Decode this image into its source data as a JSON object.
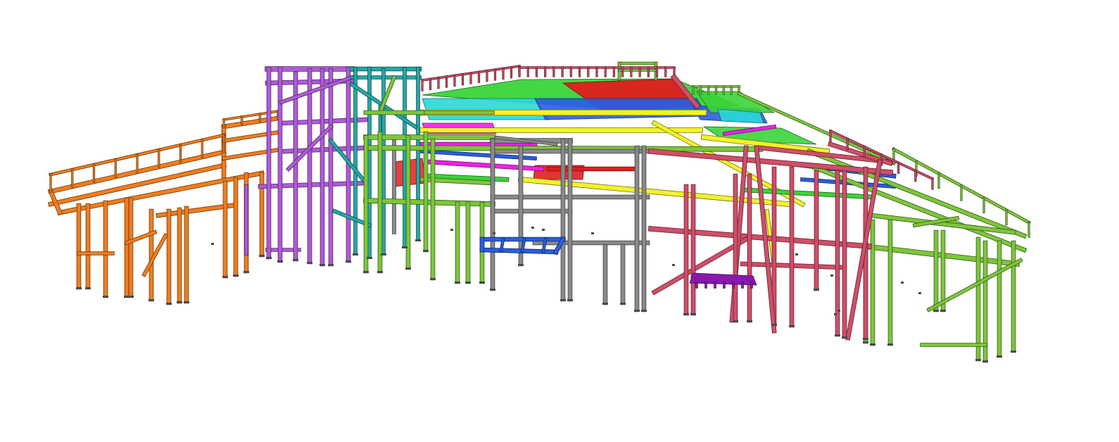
{
  "scene": {
    "background": "#ffffff",
    "groups": [
      {
        "key": "orange",
        "name": "orange-walkway-frame",
        "color": "#f07d1e"
      },
      {
        "key": "violet",
        "name": "violet-tower-frame",
        "color": "#b05ad8"
      },
      {
        "key": "teal",
        "name": "teal-stair-tower-frame",
        "color": "#23a7a7"
      },
      {
        "key": "lime",
        "name": "lime-main-frame",
        "color": "#7cc63b"
      },
      {
        "key": "gray",
        "name": "gray-frame",
        "color": "#8a8a8a"
      },
      {
        "key": "crimson",
        "name": "crimson-frame",
        "color": "#d04e68"
      },
      {
        "key": "yellow",
        "name": "yellow-beams",
        "color": "#f2f22a"
      },
      {
        "key": "magenta",
        "name": "magenta-beams",
        "color": "#f020e8"
      },
      {
        "key": "blue",
        "name": "blue-beams",
        "color": "#2a5de0"
      },
      {
        "key": "green",
        "name": "green-deck",
        "color": "#3ad43a"
      },
      {
        "key": "red",
        "name": "red-deck",
        "color": "#e01e1e"
      },
      {
        "key": "cyan",
        "name": "cyan-deck",
        "color": "#2ad8d8"
      },
      {
        "key": "purple",
        "name": "purple-platform",
        "color": "#8a18b0"
      },
      {
        "key": "dark",
        "name": "base-plates",
        "color": "#4a4a4a"
      }
    ]
  }
}
